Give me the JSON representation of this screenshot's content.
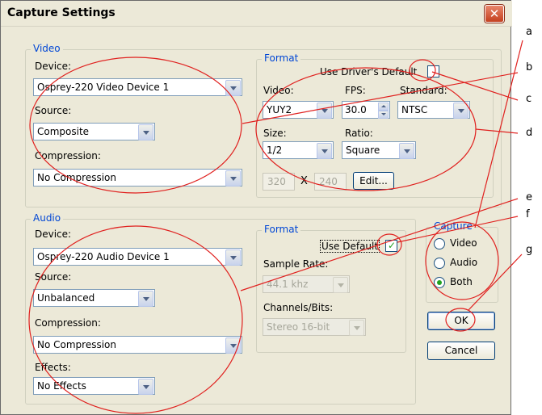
{
  "window": {
    "title": "Capture Settings",
    "close_glyph": "✕"
  },
  "video": {
    "group_label": "Video",
    "device_label": "Device:",
    "device_value": "Osprey-220 Video Device 1",
    "source_label": "Source:",
    "source_value": "Composite",
    "compression_label": "Compression:",
    "compression_value": "No Compression",
    "format": {
      "group_label": "Format",
      "use_driver_default_label": "Use Driver's Default",
      "use_driver_default_checked": false,
      "video_label": "Video:",
      "video_value": "YUY2",
      "fps_label": "FPS:",
      "fps_value": "30.0",
      "standard_label": "Standard:",
      "standard_value": "NTSC",
      "size_label": "Size:",
      "size_value": "1/2",
      "ratio_label": "Ratio:",
      "ratio_value": "Square",
      "width_value": "320",
      "x_sep": "X",
      "height_value": "240",
      "edit_label": "Edit..."
    }
  },
  "audio": {
    "group_label": "Audio",
    "device_label": "Device:",
    "device_value": "Osprey-220 Audio Device 1",
    "source_label": "Source:",
    "source_value": "Unbalanced",
    "compression_label": "Compression:",
    "compression_value": "No Compression",
    "effects_label": "Effects:",
    "effects_value": "No Effects",
    "format": {
      "group_label": "Format",
      "use_default_label": "Use Default",
      "use_default_checked": true,
      "sample_rate_label": "Sample Rate:",
      "sample_rate_value": "44.1 khz",
      "channels_label": "Channels/Bits:",
      "channels_value": "Stereo 16-bit"
    }
  },
  "capture": {
    "group_label": "Capture",
    "options": [
      "Video",
      "Audio",
      "Both"
    ],
    "selected": "Both"
  },
  "buttons": {
    "ok": "OK",
    "cancel": "Cancel"
  },
  "annotations": [
    "a",
    "b",
    "c",
    "d",
    "e",
    "f",
    "g"
  ],
  "colors": {
    "annotation": "#e0201e",
    "group_label": "#0046d5",
    "check": "#21a121"
  }
}
